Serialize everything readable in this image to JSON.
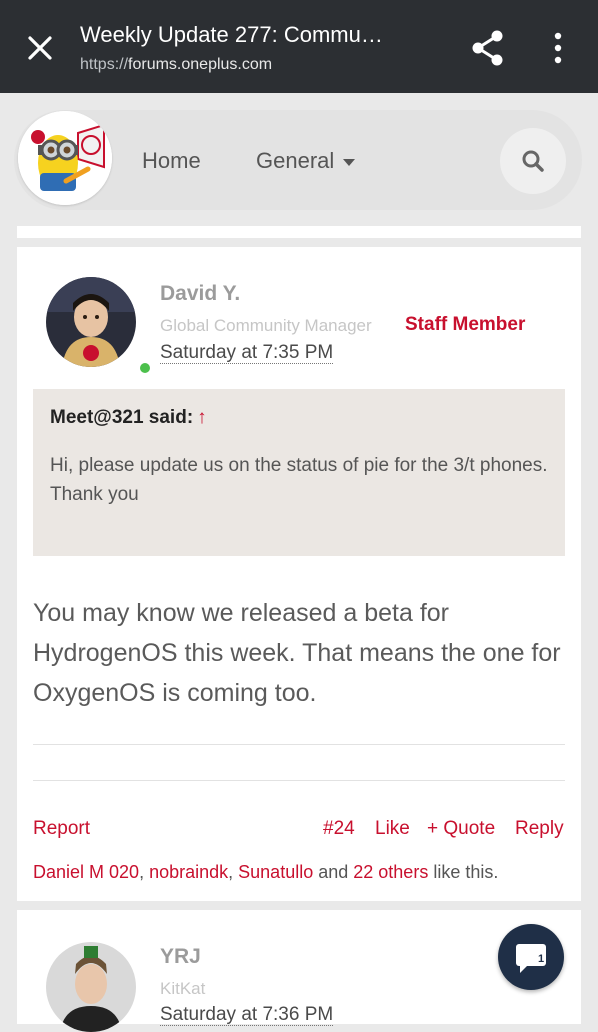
{
  "browser": {
    "title": "Weekly Update 277: Commu…",
    "url_scheme": "https://",
    "url_host": "forums.oneplus.com"
  },
  "nav": {
    "home": "Home",
    "general": "General"
  },
  "post1": {
    "author": "David Y.",
    "role": "Global Community Manager",
    "badge": "Staff Member",
    "date": "Saturday at 7:35 PM",
    "quote_author": "Meet@321 said:",
    "quote_arrow": "↑",
    "quote_text": "Hi, please update us on the status of pie for the 3/t phones. Thank you",
    "body": "You may know we released a beta for HydrogenOS this week. That means the one for OxygenOS is coming too.",
    "report": "Report",
    "post_number": "#24",
    "like": "Like",
    "quote_action": "+ Quote",
    "reply": "Reply",
    "likers": [
      "Daniel M 020",
      "nobraindk",
      "Sunatullo"
    ],
    "likers_sep1": ", ",
    "likers_sep2": ", ",
    "likes_and": " and ",
    "likes_others": "22 others",
    "likes_tail": " like this."
  },
  "post2": {
    "author": "YRJ",
    "role": "KitKat",
    "date": "Saturday at 7:36 PM"
  },
  "fab": {
    "count": "1"
  },
  "colors": {
    "accent": "#c8102e",
    "topbar": "#2c2f33",
    "fab": "#1f2f47"
  }
}
